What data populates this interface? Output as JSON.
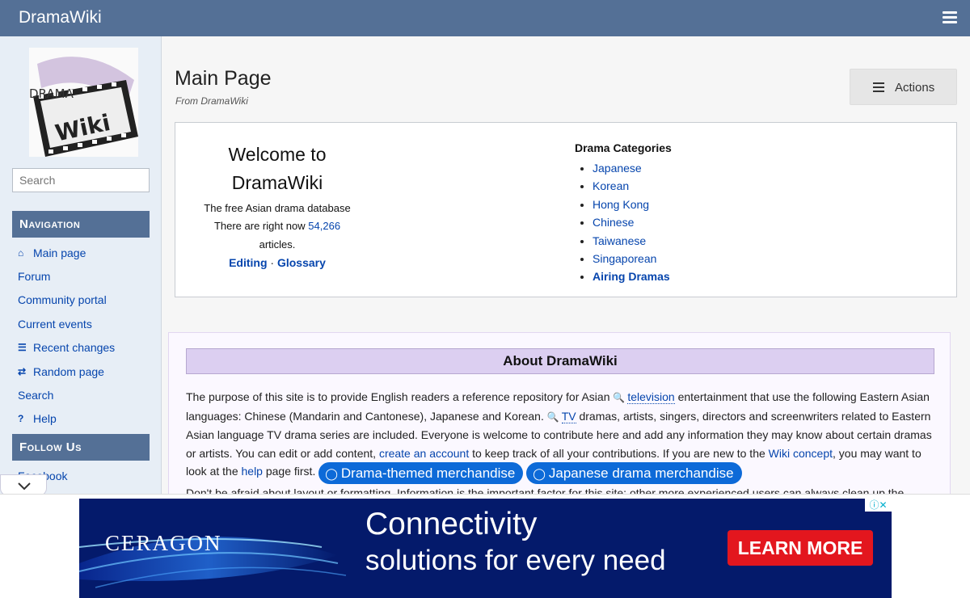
{
  "topbar": {
    "site_title": "DramaWiki"
  },
  "sidebar": {
    "search_placeholder": "Search",
    "navigation_title": "Navigation",
    "navigation_items": [
      {
        "label": "Main page",
        "icon": "home-icon"
      },
      {
        "label": "Forum",
        "icon": ""
      },
      {
        "label": "Community portal",
        "icon": ""
      },
      {
        "label": "Current events",
        "icon": ""
      },
      {
        "label": "Recent changes",
        "icon": "list-icon"
      },
      {
        "label": "Random page",
        "icon": "shuffle-icon"
      },
      {
        "label": "Search",
        "icon": ""
      },
      {
        "label": "Help",
        "icon": "question-icon"
      }
    ],
    "follow_title": "Follow Us",
    "follow_items": [
      {
        "label": "Facebook"
      }
    ]
  },
  "main": {
    "title": "Main Page",
    "subtitle": "From DramaWiki",
    "actions_label": "Actions",
    "welcome": {
      "title_line1": "Welcome to",
      "title_line2": "DramaWiki",
      "tagline": "The free Asian drama database",
      "count_prefix": "There are right now",
      "count": "54,266",
      "count_suffix": "articles.",
      "editing_label": "Editing",
      "separator": "·",
      "glossary_label": "Glossary"
    },
    "categories": {
      "title": "Drama Categories",
      "items": [
        "Japanese",
        "Korean",
        "Hong Kong",
        "Chinese",
        "Taiwanese",
        "Singaporean",
        "Airing Dramas"
      ]
    },
    "about": {
      "title": "About DramaWiki",
      "p1_a": "The purpose of this site is to provide English readers a reference repository for Asian",
      "p1_television": "television",
      "p1_b": "entertainment that use the following Eastern Asian languages: Chinese (Mandarin and Cantonese), Japanese and Korean.",
      "p1_tv": "TV",
      "p1_c": "dramas, artists, singers, directors and screenwriters related to Eastern Asian language TV drama series are included. Everyone is welcome to contribute here and add any information they may know about certain dramas or artists. You can edit or add content,",
      "p1_create": "create an account",
      "p1_d": "to keep track of all your contributions. If you are new to the",
      "p1_wiki": "Wiki concept",
      "p1_e": ", you may want to look at the",
      "p1_help": "help",
      "p1_f": "page first.",
      "pill1": "Drama-themed merchandise",
      "pill2": "Japanese drama merchandise",
      "p2": "Don't be afraid about layout or formatting. Information is the important factor for this site: other more experienced users can always clean up the"
    }
  },
  "ad": {
    "brand": "CERAGON",
    "headline": "Connectivity",
    "subline": "solutions for every need",
    "cta": "LEARN MORE",
    "adchoices": "ⓘ✕"
  },
  "colors": {
    "header": "#547096",
    "link": "#0645ad",
    "about_head": "#dccff1",
    "ad_bg": "#041a6b",
    "cta": "#e3161e",
    "pill": "#0d6ad8"
  }
}
